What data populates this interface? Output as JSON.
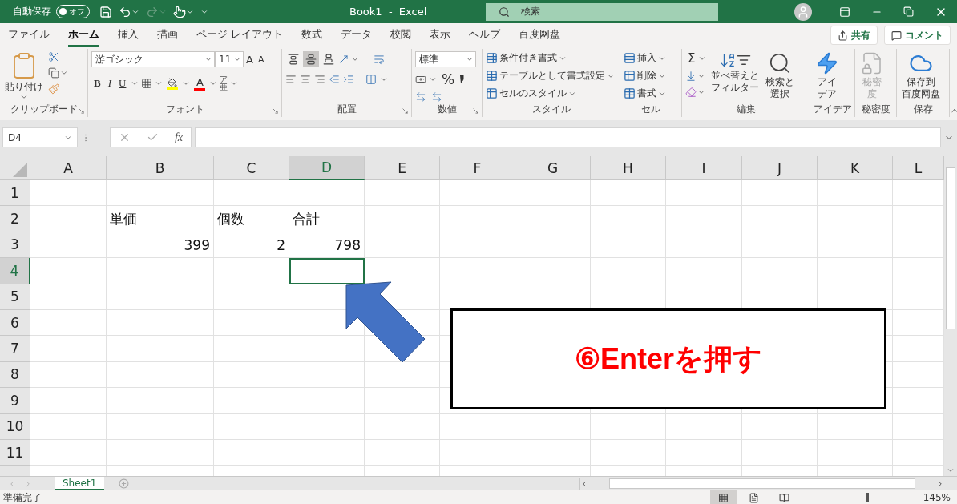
{
  "title_bar": {
    "autosave_label": "自動保存",
    "autosave_toggle": {
      "label": "オフ",
      "on": false
    },
    "redo_disabled": true,
    "title": "Book1  -  Excel",
    "search": {
      "placeholder": "検索"
    }
  },
  "tabs": [
    {
      "label": "ファイル",
      "selected": false
    },
    {
      "label": "ホーム",
      "selected": true
    },
    {
      "label": "挿入",
      "selected": false
    },
    {
      "label": "描画",
      "selected": false
    },
    {
      "label": "ページ レイアウト",
      "selected": false
    },
    {
      "label": "数式",
      "selected": false
    },
    {
      "label": "データ",
      "selected": false
    },
    {
      "label": "校閲",
      "selected": false
    },
    {
      "label": "表示",
      "selected": false
    },
    {
      "label": "ヘルプ",
      "selected": false
    },
    {
      "label": "百度网盘",
      "selected": false
    }
  ],
  "share": "共有",
  "comment": "コメント",
  "ribbon": [
    {
      "kind": "clipboard",
      "label": "クリップボード",
      "launcher": true,
      "paste": "貼り付け"
    },
    {
      "kind": "font",
      "label": "フォント",
      "launcher": true,
      "font": "游ゴシック",
      "size": "11",
      "grow": "A",
      "shrink": "A",
      "bold": "B",
      "italic": "I",
      "underline": "U",
      "font_color_letter": "A",
      "phonetic": [
        "ア",
        "亜"
      ]
    },
    {
      "kind": "alignment",
      "label": "配置",
      "launcher": true,
      "vertical": [
        {
          "kind": "top",
          "selected": false
        },
        {
          "kind": "middle",
          "selected": true
        },
        {
          "kind": "bottom",
          "selected": false
        }
      ]
    },
    {
      "kind": "number",
      "label": "数値",
      "launcher": true,
      "format": "標準",
      "percent": "%"
    },
    {
      "kind": "styles",
      "label": "スタイル",
      "launcher": false,
      "items": [
        "条件付き書式",
        "テーブルとして書式設定",
        "セルのスタイル"
      ]
    },
    {
      "kind": "cells",
      "label": "セル",
      "launcher": false,
      "items": [
        "挿入",
        "削除",
        "書式"
      ]
    },
    {
      "kind": "editing",
      "label": "編集",
      "launcher": false,
      "sum": "Σ",
      "sort": [
        "並べ替えと",
        "フィルター"
      ],
      "find": [
        "検索と",
        "選択"
      ]
    },
    {
      "kind": "ideas",
      "label": "アイデア",
      "launcher": false,
      "button": [
        "アイ",
        "デア"
      ]
    },
    {
      "kind": "sensitivity",
      "label": "秘密度",
      "launcher": false,
      "button": [
        "秘密",
        "度"
      ],
      "disabled": true
    },
    {
      "kind": "save",
      "label": "保存",
      "launcher": false,
      "button": [
        "保存到",
        "百度网盘"
      ]
    }
  ],
  "formula_bar": {
    "name_box": "D4",
    "fx": "fx"
  },
  "sheet": {
    "columns": [
      {
        "label": "A",
        "selected": false
      },
      {
        "label": "B",
        "selected": false
      },
      {
        "label": "C",
        "selected": false
      },
      {
        "label": "D",
        "selected": true
      },
      {
        "label": "E",
        "selected": false
      },
      {
        "label": "F",
        "selected": false
      },
      {
        "label": "G",
        "selected": false
      },
      {
        "label": "H",
        "selected": false
      },
      {
        "label": "I",
        "selected": false
      },
      {
        "label": "J",
        "selected": false
      },
      {
        "label": "K",
        "selected": false
      },
      {
        "label": "L",
        "selected": false
      }
    ],
    "rows": [
      {
        "label": "1",
        "selected": false
      },
      {
        "label": "2",
        "selected": false,
        "cells": [
          null,
          {
            "text": "単価",
            "kind": "text"
          },
          {
            "text": "個数",
            "kind": "text"
          },
          {
            "text": "合計",
            "kind": "text"
          }
        ]
      },
      {
        "label": "3",
        "selected": false,
        "cells": [
          null,
          {
            "text": "399",
            "kind": "number"
          },
          {
            "text": "2",
            "kind": "number"
          },
          {
            "text": "798",
            "kind": "number"
          }
        ]
      },
      {
        "label": "4",
        "selected": true
      },
      {
        "label": "5",
        "selected": false
      },
      {
        "label": "6",
        "selected": false
      },
      {
        "label": "7",
        "selected": false
      },
      {
        "label": "8",
        "selected": false
      },
      {
        "label": "9",
        "selected": false
      },
      {
        "label": "10",
        "selected": false
      },
      {
        "label": "11",
        "selected": false
      }
    ]
  },
  "annotation": {
    "text": "⑥Enterを押す"
  },
  "sheet_tabs": [
    {
      "label": "Sheet1",
      "selected": true
    }
  ],
  "status_bar": {
    "text": "準備完了",
    "views": [
      {
        "kind": "normal",
        "selected": true
      },
      {
        "kind": "layout",
        "selected": false
      },
      {
        "kind": "pagebreak",
        "selected": false
      }
    ],
    "zoom": {
      "level": 0.57,
      "reading": "145%"
    }
  }
}
